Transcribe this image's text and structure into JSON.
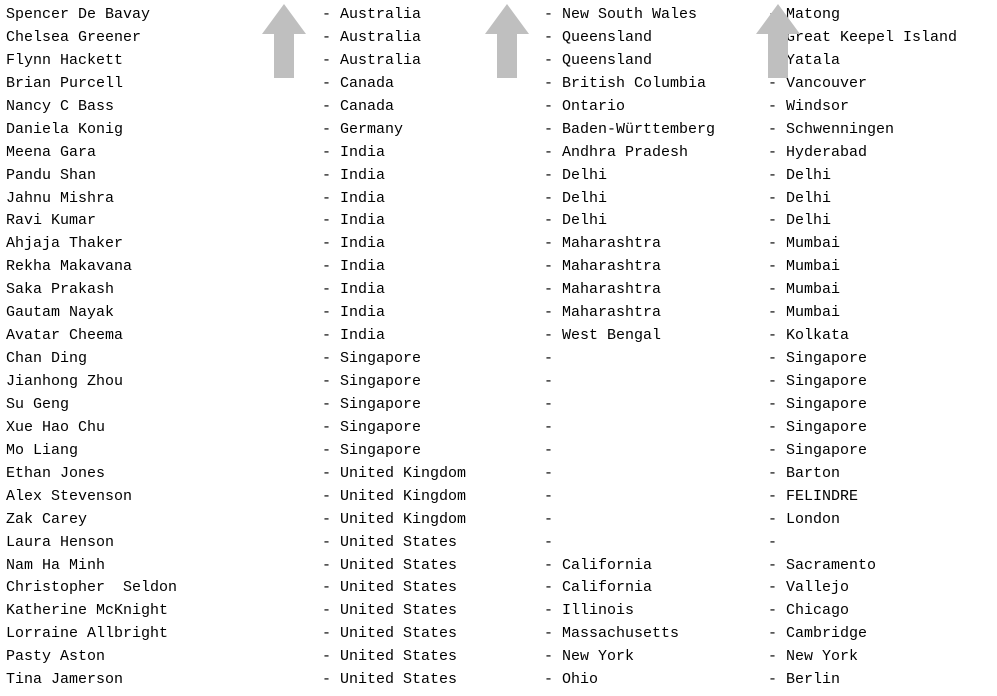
{
  "rows": [
    {
      "name": "Spencer De Bavay",
      "country": "Australia",
      "region": "New South Wales",
      "city": "Matong"
    },
    {
      "name": "Chelsea Greener",
      "country": "Australia",
      "region": "Queensland",
      "city": "Great Keepel Island"
    },
    {
      "name": "Flynn Hackett",
      "country": "Australia",
      "region": "Queensland",
      "city": "Yatala"
    },
    {
      "name": "Brian Purcell",
      "country": "Canada",
      "region": "British Columbia",
      "city": "Vancouver"
    },
    {
      "name": "Nancy C Bass",
      "country": "Canada",
      "region": "Ontario",
      "city": "Windsor"
    },
    {
      "name": "Daniela Konig",
      "country": "Germany",
      "region": "Baden-Württemberg",
      "city": "Schwenningen"
    },
    {
      "name": "Meena Gara",
      "country": "India",
      "region": "Andhra Pradesh",
      "city": "Hyderabad"
    },
    {
      "name": "Pandu Shan",
      "country": "India",
      "region": "Delhi",
      "city": "Delhi"
    },
    {
      "name": "Jahnu Mishra",
      "country": "India",
      "region": "Delhi",
      "city": "Delhi"
    },
    {
      "name": "Ravi Kumar",
      "country": "India",
      "region": "Delhi",
      "city": "Delhi"
    },
    {
      "name": "Ahjaja Thaker",
      "country": "India",
      "region": "Maharashtra",
      "city": "Mumbai"
    },
    {
      "name": "Rekha Makavana",
      "country": "India",
      "region": "Maharashtra",
      "city": "Mumbai"
    },
    {
      "name": "Saka Prakash",
      "country": "India",
      "region": "Maharashtra",
      "city": "Mumbai"
    },
    {
      "name": "Gautam Nayak",
      "country": "India",
      "region": "Maharashtra",
      "city": "Mumbai"
    },
    {
      "name": "Avatar Cheema",
      "country": "India",
      "region": "West Bengal",
      "city": "Kolkata"
    },
    {
      "name": "Chan Ding",
      "country": "Singapore",
      "region": "",
      "city": "Singapore"
    },
    {
      "name": "Jianhong Zhou",
      "country": "Singapore",
      "region": "",
      "city": "Singapore"
    },
    {
      "name": "Su Geng",
      "country": "Singapore",
      "region": "",
      "city": "Singapore"
    },
    {
      "name": "Xue Hao Chu",
      "country": "Singapore",
      "region": "",
      "city": "Singapore"
    },
    {
      "name": "Mo Liang",
      "country": "Singapore",
      "region": "",
      "city": "Singapore"
    },
    {
      "name": "Ethan Jones",
      "country": "United Kingdom",
      "region": "",
      "city": "Barton"
    },
    {
      "name": "Alex Stevenson",
      "country": "United Kingdom",
      "region": "",
      "city": "FELINDRE"
    },
    {
      "name": "Zak Carey",
      "country": "United Kingdom",
      "region": "",
      "city": "London"
    },
    {
      "name": "Laura Henson",
      "country": "United States",
      "region": "",
      "city": ""
    },
    {
      "name": "Nam Ha Minh",
      "country": "United States",
      "region": "California",
      "city": "Sacramento"
    },
    {
      "name": "Christopher  Seldon",
      "country": "United States",
      "region": "California",
      "city": "Vallejo"
    },
    {
      "name": "Katherine McKnight",
      "country": "United States",
      "region": "Illinois",
      "city": "Chicago"
    },
    {
      "name": "Lorraine Allbright",
      "country": "United States",
      "region": "Massachusetts",
      "city": "Cambridge"
    },
    {
      "name": "Pasty Aston",
      "country": "United States",
      "region": "New York",
      "city": "New York"
    },
    {
      "name": "Tina Jamerson",
      "country": "United States",
      "region": "Ohio",
      "city": "Berlin"
    }
  ],
  "separator": "- "
}
